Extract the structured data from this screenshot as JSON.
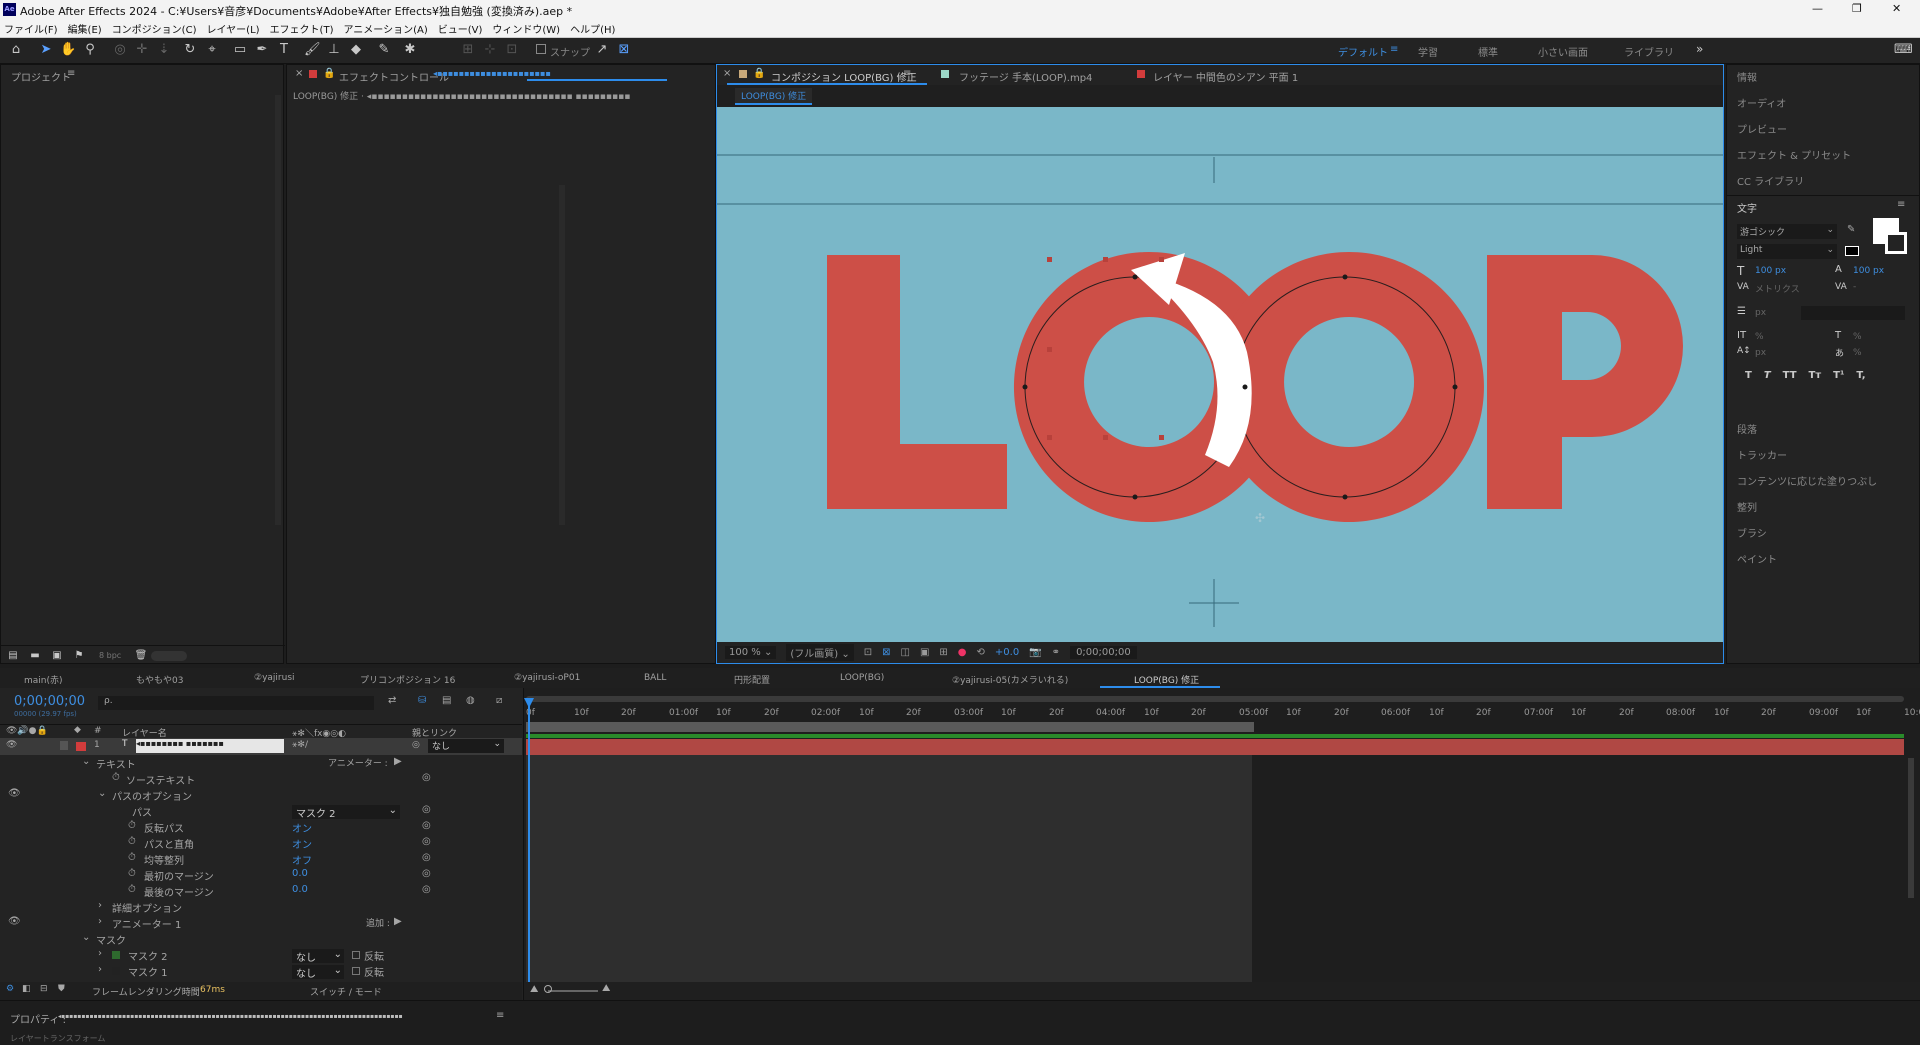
{
  "window": {
    "title": "Adobe After Effects 2024 - C:¥Users¥音彦¥Documents¥Adobe¥After Effects¥独自勉強 (変換済み).aep *",
    "min": "—",
    "max": "❐",
    "close": "✕"
  },
  "menu": [
    "ファイル(F)",
    "編集(E)",
    "コンポジション(C)",
    "レイヤー(L)",
    "エフェクト(T)",
    "アニメーション(A)",
    "ビュー(V)",
    "ウィンドウ(W)",
    "ヘルプ(H)"
  ],
  "toolbar": {
    "snap_label": "スナップ",
    "workspaces": [
      "デフォルト",
      "学習",
      "標準",
      "小さい画面",
      "ライブラリ"
    ],
    "more": "»"
  },
  "project": {
    "title": "プロジェクト",
    "bpc": "8 bpc"
  },
  "effects": {
    "tab": "エフェクトコントロール",
    "tab_target": "◂▪▪▪▪▪▪▪▪▪▪▪▪▪▪▪▪▪▪▪▪▪",
    "layer_label": "LOOP(BG) 修正 · ◂▪▪▪▪▪▪▪▪▪▪▪▪▪▪▪▪▪▪▪▪▪▪▪▪▪▪▪▪▪▪▪▪▪ ▪▪▪▪▪▪▪▪▪"
  },
  "viewer": {
    "tabs": [
      {
        "label": "コンポジション LOOP(BG) 修正"
      },
      {
        "label": "フッテージ 手本(LOOP).mp4"
      },
      {
        "label": "レイヤー 中間色のシアン 平面 1"
      }
    ],
    "breadcrumb": "LOOP(BG) 修正",
    "text": "LOOP",
    "zoom": "100 %",
    "quality": "(フル画質)",
    "exposure": "+0.0",
    "timecode": "0;00;00;00"
  },
  "right": {
    "items": [
      "情報",
      "オーディオ",
      "プレビュー",
      "エフェクト & プリセット",
      "CC ライブラリ"
    ],
    "character": {
      "title": "文字",
      "font": "游ゴシック",
      "style": "Light",
      "size": "100 px",
      "leading": "100 px",
      "kerning": "メトリクス",
      "tracking": "-",
      "stroke_unit": "px",
      "vscale": "%",
      "hscale": "%",
      "baseline": "px",
      "tsume": "%",
      "styles": [
        "T",
        "T",
        "TT",
        "Tт",
        "T¹",
        "T,"
      ]
    },
    "items2": [
      "段落",
      "トラッカー",
      "コンテンツに応じた塗りつぶし",
      "整列",
      "ブラシ",
      "ペイント"
    ]
  },
  "comp_tabs": [
    "main(赤)",
    "もやもや03",
    "②yajirusi",
    "プリコンポジション 16",
    "②yajirusi-oP01",
    "BALL",
    "円形配置",
    "LOOP(BG)",
    "②yajirusi-05(カメラいれる)",
    "LOOP(BG) 修正"
  ],
  "timeline": {
    "timecode": "0;00;00;00",
    "fps": "00000 (29.97 fps)",
    "search_placeholder": "ρ.",
    "col_layer_name": "レイヤー名",
    "col_parent": "親とリンク",
    "layer_num": "1",
    "layer_type": "T",
    "layer_name": "◂▪▪▪▪▪▪▪▪ ▪▪▪▪▪▪▪",
    "parent": "なし",
    "rows": [
      {
        "label": "テキスト",
        "right": "アニメーター :",
        "indent": 1
      },
      {
        "label": "ソーステキスト",
        "indent": 3
      },
      {
        "label": "パスのオプション",
        "indent": 2
      },
      {
        "label": "パス",
        "value": "マスク 2",
        "indent": 3
      },
      {
        "label": "反転パス",
        "value": "オン",
        "indent": 3
      },
      {
        "label": "パスと直角",
        "value": "オン",
        "indent": 3
      },
      {
        "label": "均等整列",
        "value": "オフ",
        "indent": 3
      },
      {
        "label": "最初のマージン",
        "value": "0.0",
        "indent": 3
      },
      {
        "label": "最後のマージン",
        "value": "0.0",
        "indent": 3
      },
      {
        "label": "詳細オプション",
        "indent": 2
      },
      {
        "label": "アニメーター 1",
        "right": "追加 :",
        "indent": 2
      },
      {
        "label": "マスク",
        "indent": 1
      },
      {
        "label": "マスク 2",
        "mode": "なし",
        "extra": "反転",
        "indent": 2
      },
      {
        "label": "マスク 1",
        "mode": "なし",
        "extra": "反転",
        "indent": 2
      }
    ],
    "ruler": [
      "0f",
      "10f",
      "20f",
      "01:00f",
      "10f",
      "20f",
      "02:00f",
      "10f",
      "20f",
      "03:00f",
      "10f",
      "20f",
      "04:00f",
      "10f",
      "20f",
      "05:00f",
      "10f",
      "20f",
      "06:00f",
      "10f",
      "20f",
      "07:00f",
      "10f",
      "20f",
      "08:00f",
      "10f",
      "20f",
      "09:00f",
      "10f",
      "10:0"
    ],
    "render_time_label": "フレームレンダリング時間",
    "render_time": "67ms",
    "switch_mode": "スイッチ / モード"
  },
  "properties": {
    "label": "プロパティ :",
    "value": "◂▪▪▪▪▪▪▪▪▪▪▪▪▪▪▪▪▪▪▪▪▪▪▪▪▪▪▪▪▪▪▪▪▪▪▪▪▪▪▪▪▪▪▪▪▪▪▪▪▪▪▪▪▪▪▪▪▪▪▪▪▪▪▪▪▪▪▪▪▪▪▪▪▪▪▪▪▪▪▪▪▪▪▪▪",
    "footer": "レイヤートランスフォーム"
  },
  "colors": {
    "bg": "#7ab7c8",
    "letter": "#cd4f47",
    "accent": "#2d8ceb"
  }
}
